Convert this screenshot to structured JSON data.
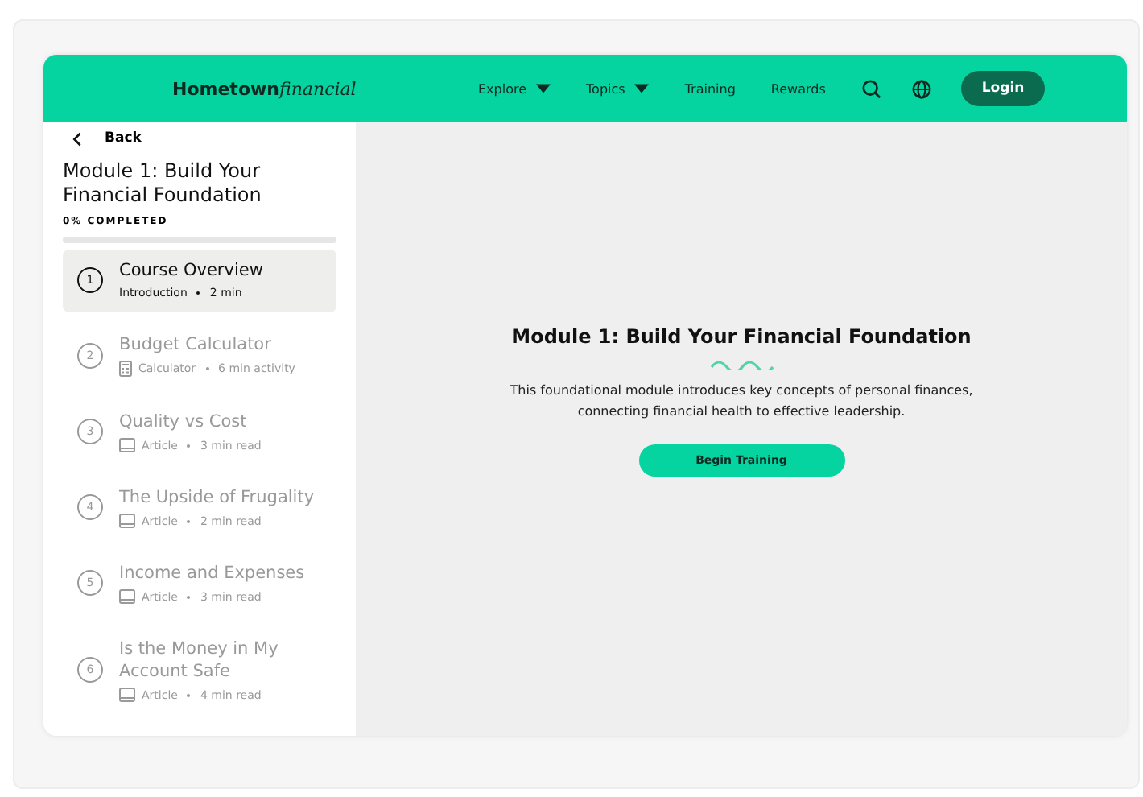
{
  "header": {
    "logo": {
      "main": "Hometown",
      "italic": "financial"
    },
    "nav": [
      {
        "label": "Explore",
        "has_menu": true
      },
      {
        "label": "Topics",
        "has_menu": true
      },
      {
        "label": "Training",
        "has_menu": false
      },
      {
        "label": "Rewards",
        "has_menu": false
      }
    ],
    "login": "Login"
  },
  "sidebar": {
    "back": "Back",
    "title": "Module 1: Build Your Financial Foundation",
    "progress_label": "0% COMPLETED",
    "progress": {
      "level": 0
    },
    "lessons": [
      {
        "number": "1",
        "title": "Course Overview",
        "kind": "intro",
        "type": "Introduction",
        "duration": "2 min",
        "selected": true
      },
      {
        "number": "2",
        "title": "Budget Calculator",
        "kind": "calculator",
        "type": "Calculator",
        "duration": "6 min activity",
        "selected": false
      },
      {
        "number": "3",
        "title": "Quality vs Cost",
        "kind": "article",
        "type": "Article",
        "duration": "3 min read",
        "selected": false
      },
      {
        "number": "4",
        "title": "The Upside of Frugality",
        "kind": "article",
        "type": "Article",
        "duration": "2 min read",
        "selected": false
      },
      {
        "number": "5",
        "title": "Income and Expenses",
        "kind": "article",
        "type": "Article",
        "duration": "3 min read",
        "selected": false
      },
      {
        "number": "6",
        "title": "Is the Money in My Account Safe",
        "kind": "article",
        "type": "Article",
        "duration": "4 min read",
        "selected": false
      }
    ]
  },
  "main": {
    "title": "Module 1: Build Your Financial Foundation",
    "description": "This foundational module introduces key concepts of personal finances, connecting financial health to effective leadership.",
    "button": "Begin Training"
  }
}
